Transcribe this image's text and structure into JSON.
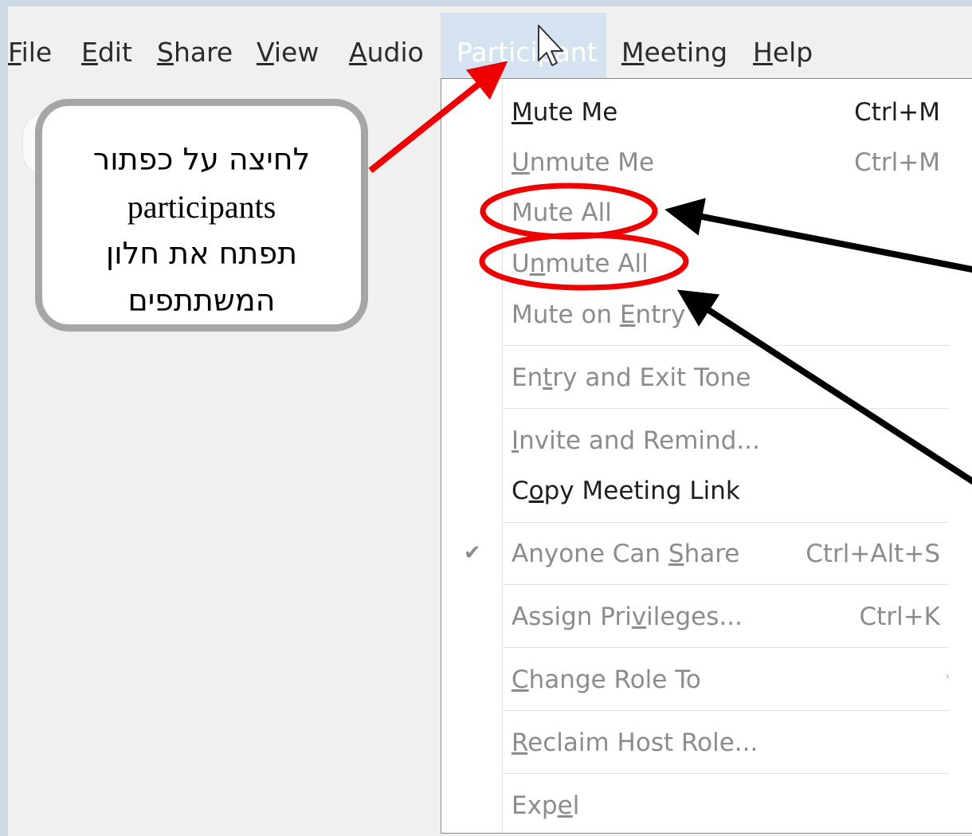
{
  "menubar": {
    "items": [
      {
        "key": "F",
        "rest": "ile",
        "label": "File"
      },
      {
        "key": "E",
        "rest": "dit",
        "label": "Edit"
      },
      {
        "key": "S",
        "rest": "hare",
        "label": "Share"
      },
      {
        "key": "V",
        "rest": "iew",
        "label": "View"
      },
      {
        "key": "A",
        "rest": "udio",
        "label": "Audio"
      },
      {
        "label": "Participant"
      },
      {
        "key": "M",
        "rest": "eeting",
        "label": "Meeting"
      },
      {
        "key": "H",
        "rest": "elp",
        "label": "Help"
      }
    ]
  },
  "dropdown": {
    "items": [
      {
        "pre": "",
        "key": "M",
        "post": "ute Me",
        "shortcut": "Ctrl+M"
      },
      {
        "pre": "",
        "key": "U",
        "post": "nmute Me",
        "shortcut": "Ctrl+M"
      },
      {
        "label": "Mute All"
      },
      {
        "pre": "U",
        "key": "n",
        "post": "mute All"
      },
      {
        "pre": "Mute on ",
        "key": "E",
        "post": "ntry"
      },
      {
        "pre": "En",
        "key": "t",
        "post": "ry and Exit Tone"
      },
      {
        "pre": "",
        "key": "I",
        "post": "nvite and Remind..."
      },
      {
        "pre": "C",
        "key": "o",
        "post": "py Meeting Link"
      },
      {
        "pre": "Anyone Can ",
        "key": "S",
        "post": "hare",
        "shortcut": "Ctrl+Alt+S",
        "checked": true
      },
      {
        "pre": "Assign Pri",
        "key": "v",
        "post": "ileges...",
        "shortcut": "Ctrl+K"
      },
      {
        "pre": "",
        "key": "C",
        "post": "hange Role To",
        "has_submenu": true
      },
      {
        "pre": "",
        "key": "R",
        "post": "eclaim Host Role..."
      },
      {
        "pre": "Exp",
        "key": "e",
        "post": "l"
      }
    ]
  },
  "callout": {
    "line1": "לחיצה על כפתור",
    "line2": "participants",
    "line3": "תפתח את חלון",
    "line4": "המשתתפים"
  },
  "colors": {
    "annotation_red": "#ee0000",
    "annotation_black": "#000000",
    "menu_highlight": "#d4e3ef",
    "disabled_text": "#8c8c8c"
  },
  "icons": {
    "cursor": "mouse-pointer-icon",
    "check": "checkmark-icon",
    "submenu": "chevron-right-icon"
  }
}
